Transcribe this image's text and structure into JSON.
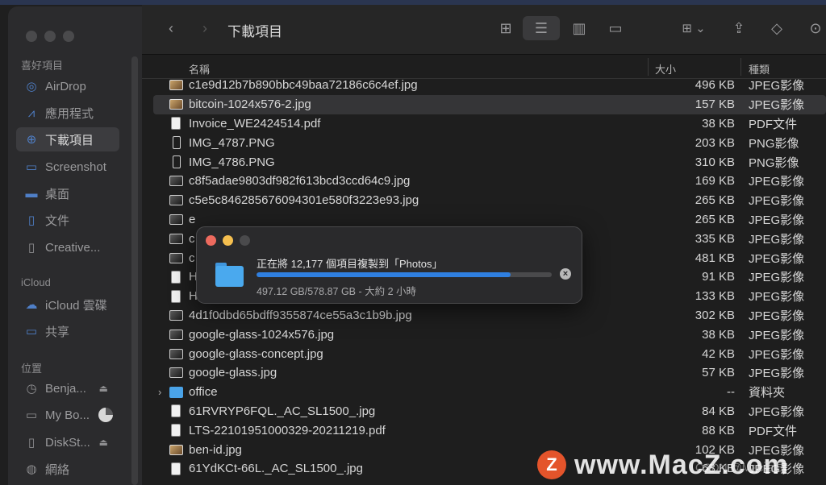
{
  "window": {
    "title": "下載項目"
  },
  "sidebar": {
    "sections": [
      {
        "label": "喜好項目"
      },
      {
        "label": "iCloud"
      },
      {
        "label": "位置"
      }
    ],
    "items": [
      {
        "label": "AirDrop",
        "icon": "airdrop-icon"
      },
      {
        "label": "應用程式",
        "icon": "applications-icon"
      },
      {
        "label": "下載項目",
        "icon": "downloads-icon",
        "active": true
      },
      {
        "label": "Screenshot",
        "icon": "folder-icon"
      },
      {
        "label": "桌面",
        "icon": "desktop-icon"
      },
      {
        "label": "文件",
        "icon": "document-icon"
      },
      {
        "label": "Creative...",
        "icon": "file-icon"
      },
      {
        "label": "iCloud 雲碟",
        "icon": "cloud-icon"
      },
      {
        "label": "共享",
        "icon": "shared-folder-icon"
      },
      {
        "label": "Benja...",
        "icon": "clock-icon"
      },
      {
        "label": "My Bo...",
        "icon": "drive-icon"
      },
      {
        "label": "DiskSt...",
        "icon": "file-icon"
      },
      {
        "label": "網絡",
        "icon": "globe-icon"
      }
    ]
  },
  "columns": {
    "name": "名稱",
    "size": "大小",
    "kind": "種類"
  },
  "files": [
    {
      "name": "c1e9d12b7b890bbc49baa72186c6c4ef.jpg",
      "size": "496 KB",
      "kind": "JPEG影像",
      "icon": "img"
    },
    {
      "name": "bitcoin-1024x576-2.jpg",
      "size": "157 KB",
      "kind": "JPEG影像",
      "icon": "img",
      "selected": true
    },
    {
      "name": "Invoice_WE2424514.pdf",
      "size": "38 KB",
      "kind": "PDF文件",
      "icon": "doc"
    },
    {
      "name": "IMG_4787.PNG",
      "size": "203 KB",
      "kind": "PNG影像",
      "icon": "phone"
    },
    {
      "name": "IMG_4786.PNG",
      "size": "310 KB",
      "kind": "PNG影像",
      "icon": "phone"
    },
    {
      "name": "c8f5adae9803df982f613bcd3ccd64c9.jpg",
      "size": "169 KB",
      "kind": "JPEG影像",
      "icon": "dark"
    },
    {
      "name": "c5e5c846285676094301e580f3223e93.jpg",
      "size": "265 KB",
      "kind": "JPEG影像",
      "icon": "dark"
    },
    {
      "name": "e",
      "size": "265 KB",
      "kind": "JPEG影像",
      "icon": "dark"
    },
    {
      "name": "c",
      "size": "335 KB",
      "kind": "JPEG影像",
      "icon": "dark"
    },
    {
      "name": "c",
      "size": "481 KB",
      "kind": "JPEG影像",
      "icon": "dark"
    },
    {
      "name": "H",
      "size": "91 KB",
      "kind": "JPEG影像",
      "icon": "doc"
    },
    {
      "name": "HPP82-2.jpeg",
      "size": "133 KB",
      "kind": "JPEG影像",
      "icon": "doc"
    },
    {
      "name": "4d1f0dbd65bdff9355874ce55a3c1b9b.jpg",
      "size": "302 KB",
      "kind": "JPEG影像",
      "icon": "dark"
    },
    {
      "name": "google-glass-1024x576.jpg",
      "size": "38 KB",
      "kind": "JPEG影像",
      "icon": "dark"
    },
    {
      "name": "google-glass-concept.jpg",
      "size": "42 KB",
      "kind": "JPEG影像",
      "icon": "dark"
    },
    {
      "name": "google-glass.jpg",
      "size": "57 KB",
      "kind": "JPEG影像",
      "icon": "dark"
    },
    {
      "name": "office",
      "size": "--",
      "kind": "資料夾",
      "icon": "folder",
      "expandable": true
    },
    {
      "name": "61RVRYP6FQL._AC_SL1500_.jpg",
      "size": "84 KB",
      "kind": "JPEG影像",
      "icon": "doc"
    },
    {
      "name": "LTS-22101951000329-20211219.pdf",
      "size": "88 KB",
      "kind": "PDF文件",
      "icon": "doc"
    },
    {
      "name": "ben-id.jpg",
      "size": "102 KB",
      "kind": "JPEG影像",
      "icon": "img"
    },
    {
      "name": "61YdKCt-66L._AC_SL1500_.jpg",
      "size": "63 KB",
      "kind": "JPEG影像",
      "icon": "doc"
    }
  ],
  "copy_dialog": {
    "message": "正在將 12,177 個項目複製到「Photos」",
    "detail": "497.12 GB/578.87 GB - 大約 2 小時",
    "progress": 0.86
  },
  "watermark": {
    "logo_letter": "Z",
    "text": "www.MacZ.com",
    "small": "CSDN @Mac百辰"
  },
  "colors": {
    "accent": "#2f7fe0",
    "close": "#ed6a5e",
    "minimize": "#f5bf4f",
    "folder": "#4aa9ee"
  }
}
